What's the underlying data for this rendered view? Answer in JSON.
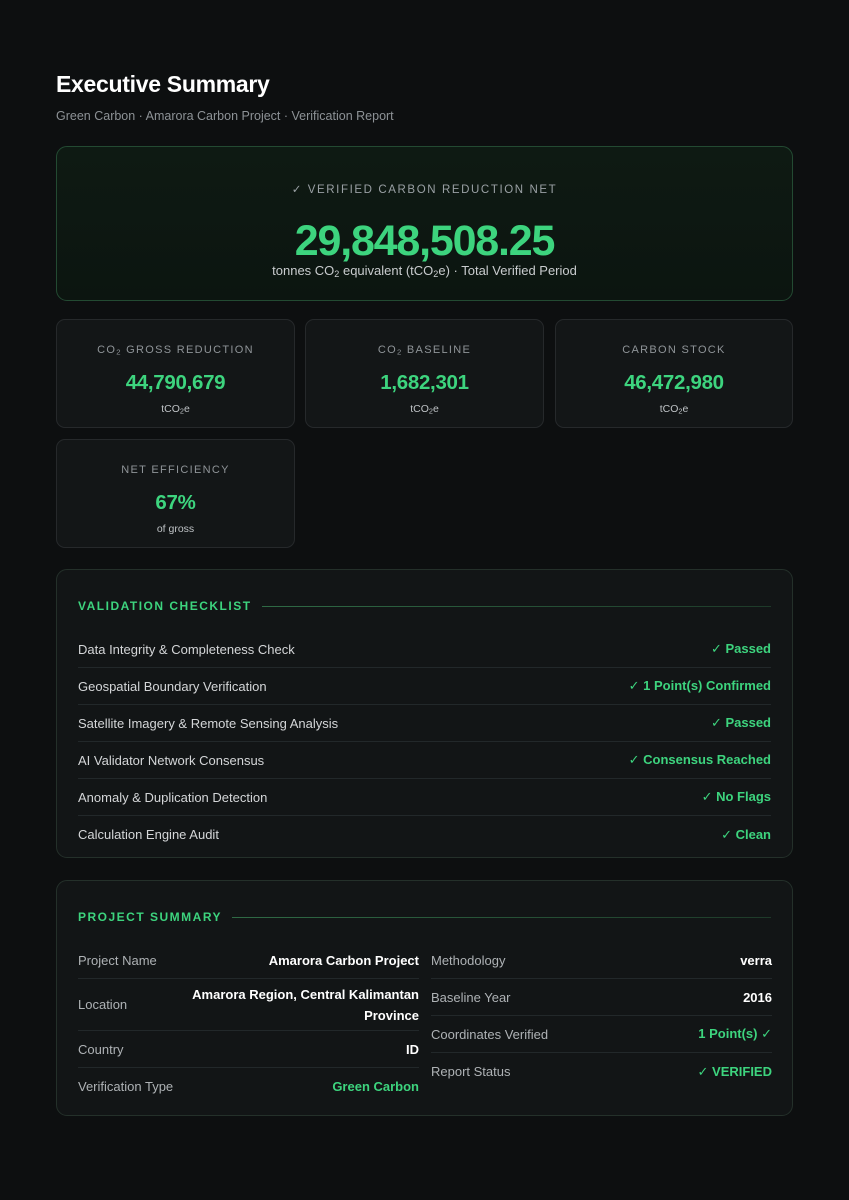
{
  "header": {
    "title": "Executive Summary",
    "subtitle": "Green Carbon · Amarora Carbon Project · Verification Report"
  },
  "hero": {
    "label": "✓ VERIFIED CARBON REDUCTION NET",
    "value": "29,848,508.25",
    "unit_prefix": "tonnes CO",
    "unit_sub": "2",
    "unit_suffix": " equivalent (tCO",
    "unit_sub2": "2",
    "unit_end": "e) · Total Verified Period"
  },
  "stats": [
    {
      "label_a": "CO",
      "label_sub": "2",
      "label_b": " GROSS REDUCTION",
      "value": "44,790,679",
      "unit_a": "tCO",
      "unit_sub": "2",
      "unit_b": "e"
    },
    {
      "label_a": "CO",
      "label_sub": "2",
      "label_b": " BASELINE",
      "value": "1,682,301",
      "unit_a": "tCO",
      "unit_sub": "2",
      "unit_b": "e"
    },
    {
      "label_a": "CARBON STOCK",
      "label_sub": "",
      "label_b": "",
      "value": "46,472,980",
      "unit_a": "tCO",
      "unit_sub": "2",
      "unit_b": "e"
    },
    {
      "label_a": "NET EFFICIENCY",
      "label_sub": "",
      "label_b": "",
      "value": "67%",
      "unit_a": "of gross",
      "unit_sub": "",
      "unit_b": ""
    }
  ],
  "checklist": {
    "title": "VALIDATION CHECKLIST",
    "items": [
      {
        "label": "Data Integrity & Completeness Check",
        "status": "✓ Passed"
      },
      {
        "label": "Geospatial Boundary Verification",
        "status": "✓ 1 Point(s) Confirmed"
      },
      {
        "label": "Satellite Imagery & Remote Sensing Analysis",
        "status": "✓ Passed"
      },
      {
        "label": "AI Validator Network Consensus",
        "status": "✓ Consensus Reached"
      },
      {
        "label": "Anomaly & Duplication Detection",
        "status": "✓ No Flags"
      },
      {
        "label": "Calculation Engine Audit",
        "status": "✓ Clean"
      }
    ]
  },
  "summary": {
    "title": "PROJECT SUMMARY",
    "left": [
      {
        "key": "Project Name",
        "value": "Amarora Carbon Project"
      },
      {
        "key": "Location",
        "value_line1": "Amarora Region, Central Kalimantan",
        "value_line2": "Province"
      },
      {
        "key": "Country",
        "value": "ID"
      },
      {
        "key": "Verification Type",
        "value": "Green Carbon"
      }
    ],
    "right": [
      {
        "key": "Methodology",
        "value": "verra"
      },
      {
        "key": "Baseline Year",
        "value": "2016"
      },
      {
        "key": "Coordinates Verified",
        "value": "1 Point(s) ✓"
      },
      {
        "key": "Report Status",
        "value": "✓ VERIFIED"
      }
    ]
  },
  "colors": {
    "background": "#0d0f10",
    "accent_green": "#3dd47e",
    "card": "#131617",
    "hero_border": "#234a32"
  }
}
